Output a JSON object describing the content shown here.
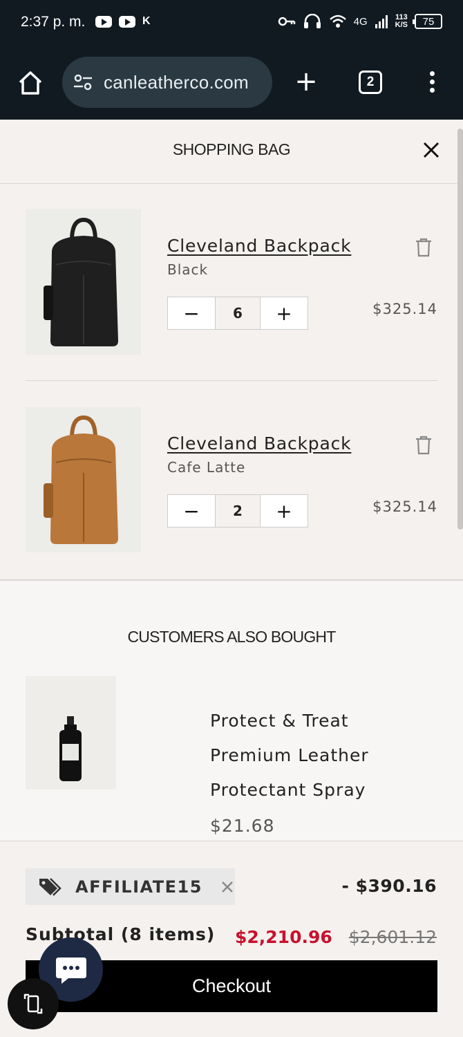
{
  "status_bar": {
    "time": "2:37 p. m.",
    "network_type": "4G",
    "speed_value": "113",
    "speed_unit": "K/S",
    "battery": "75"
  },
  "browser": {
    "url": "canleatherco.com",
    "tab_count": "2"
  },
  "cart": {
    "title": "SHOPPING BAG",
    "items": [
      {
        "name": "Cleveland Backpack",
        "variant": "Black",
        "quantity": "6",
        "price": "$325.14",
        "color": "#1f1f1f"
      },
      {
        "name": "Cleveland Backpack",
        "variant": "Cafe Latte",
        "quantity": "2",
        "price": "$325.14",
        "color": "#b9773a"
      }
    ],
    "minus_label": "−",
    "plus_label": "+"
  },
  "upsell": {
    "title": "CUSTOMERS ALSO BOUGHT",
    "product": {
      "name": "Protect & Treat Premium Leather Protectant Spray",
      "price": "$21.68"
    }
  },
  "footer": {
    "discount_code": "AFFILIATE15",
    "discount_amount": "- $390.16",
    "subtotal_label": "Subtotal (8 items)",
    "subtotal_price": "$2,210.96",
    "subtotal_original": "$2,601.12",
    "checkout_label": "Checkout"
  },
  "colors": {
    "sale_red": "#c8102e",
    "browser_bar": "#111a21",
    "chat_bubble": "#1e2a44"
  }
}
